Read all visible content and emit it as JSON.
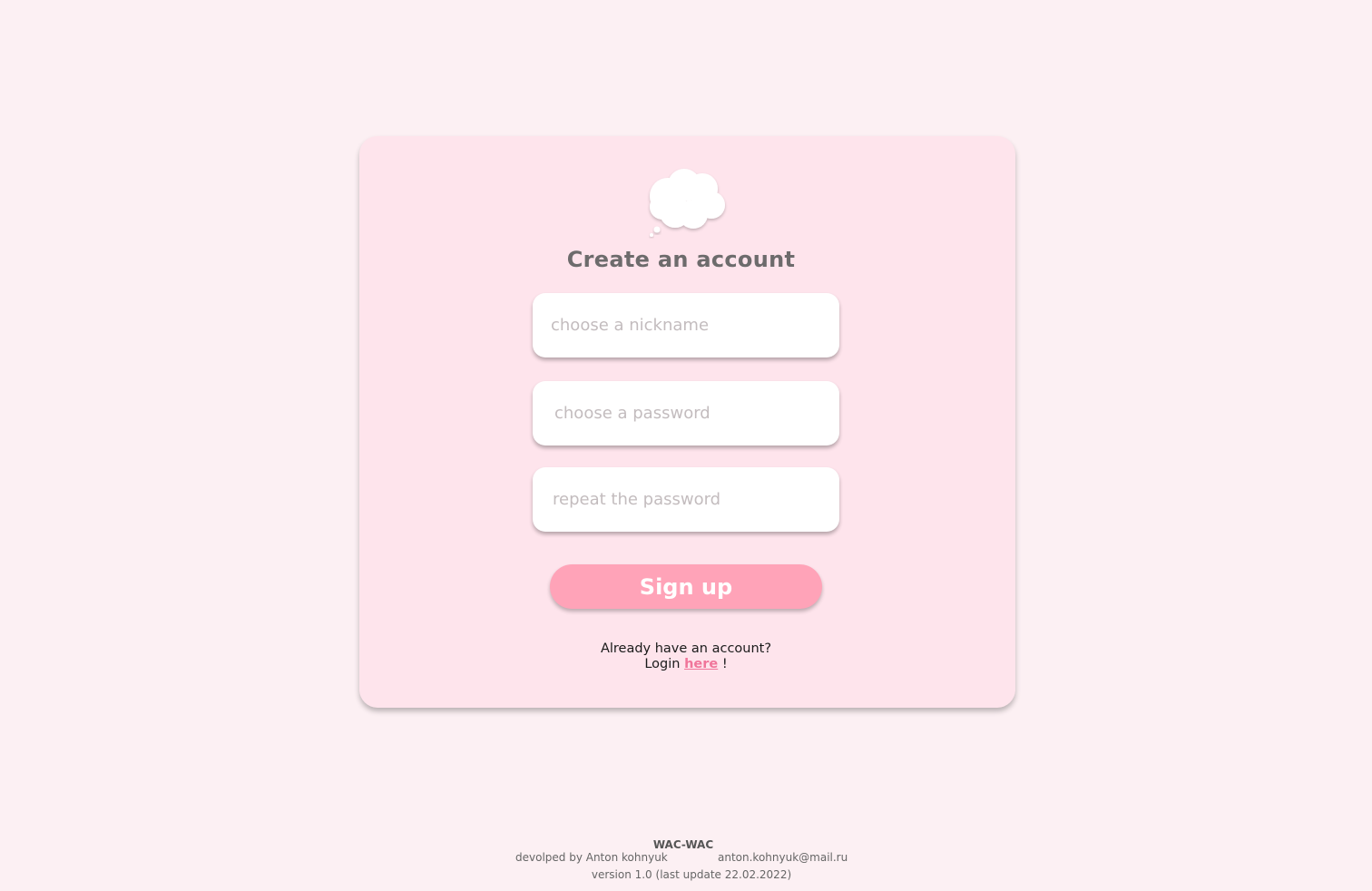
{
  "colors": {
    "page_bg": "#fcf0f3",
    "card_bg": "#fee4ec",
    "title": "#6d6b6c",
    "button": "#ffa3b8",
    "link": "#f0759a"
  },
  "logo": {
    "icon": "thought-cloud-icon"
  },
  "form": {
    "title": "Create an account",
    "nickname_placeholder": "choose a nickname",
    "password_placeholder": "choose a password",
    "repeat_placeholder": "repeat the password",
    "submit_label": "Sign up"
  },
  "login": {
    "question": "Already have an account?",
    "prefix": "Login",
    "link": "here",
    "suffix": "!"
  },
  "footer": {
    "app_name": "WAC-WAC",
    "developer": "devolped by Anton kohnyuk",
    "email": "anton.kohnyuk@mail.ru",
    "version": "version 1.0 (last update 22.02.2022)"
  }
}
